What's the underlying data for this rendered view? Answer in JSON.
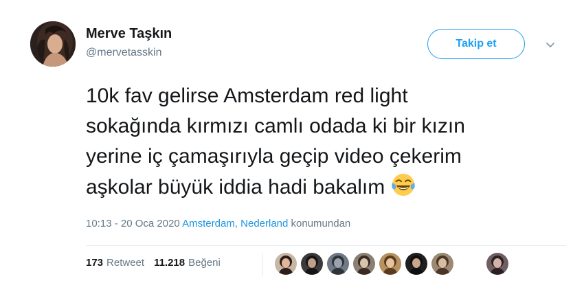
{
  "user": {
    "display_name": "Merve Taşkın",
    "handle": "@mervetasskin"
  },
  "follow_button": {
    "label": "Takip et"
  },
  "tweet": {
    "lines": [
      "10k fav gelirse Amsterdam red light",
      "sokağında kırmızı camlı odada ki bir kızın",
      "yerine iç çamaşırıyla geçip video çekerim",
      "aşkolar büyük iddia hadi bakalım"
    ],
    "emoji": "face-with-tears-of-joy"
  },
  "meta": {
    "timestamp": "10:13 - 20 Oca 2020",
    "location_city": "Amsterdam",
    "location_sep": ", ",
    "location_country": "Nederland",
    "location_suffix": " konumundan"
  },
  "stats": {
    "retweets_count": "173",
    "retweets_label": "Retweet",
    "likes_count": "11.218",
    "likes_label": "Beğeni"
  },
  "likers": [
    {
      "bg": "#c9b7a6",
      "face": "#e0b598",
      "hair": "#2b1e18"
    },
    {
      "bg": "#3b3b3b",
      "face": "#bfa089",
      "hair": "#151515"
    },
    {
      "bg": "#6f7a86",
      "face": "#9aa3ad",
      "hair": "#2e343a"
    },
    {
      "bg": "#8a8074",
      "face": "#d8c4ae",
      "hair": "#3a2a22"
    },
    {
      "bg": "#b5925f",
      "face": "#e6c39c",
      "hair": "#5b3a1e"
    },
    {
      "bg": "#1f1f1f",
      "face": "#c9a58a",
      "hair": "#0e0e0e"
    },
    {
      "bg": "#9b8a73",
      "face": "#d9bda0",
      "hair": "#4a3526"
    },
    {
      "bg": "#6e5f63",
      "face": "#d2b3a8",
      "hair": "#2c1f22"
    }
  ],
  "colors": {
    "accent": "#1da1f2",
    "link": "#1b95e0",
    "muted": "#657786",
    "text": "#14171a"
  }
}
